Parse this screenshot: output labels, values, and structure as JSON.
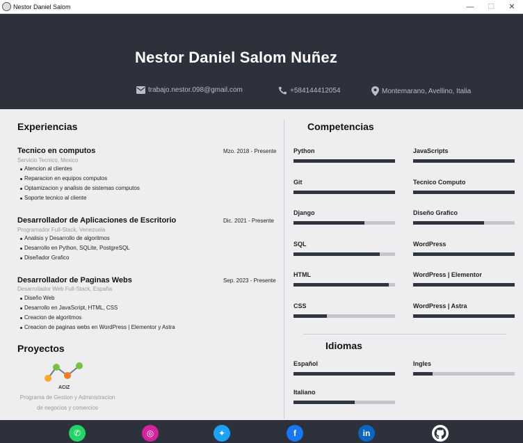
{
  "window": {
    "title": "Nestor Daniel Salom",
    "controls": [
      "—",
      "☐",
      "✕"
    ]
  },
  "header": {
    "name": "Nestor Daniel Salom Nuñez",
    "email": "trabajo.nestor.098@gmail.com",
    "phone": "+584144412054",
    "location": "Montemarano, Avellino, Italia"
  },
  "experience": {
    "heading": "Experiencias",
    "jobs": [
      {
        "title": "Tecnico en computos",
        "date": "Mzo. 2018 - Presente",
        "subtitle": "Servicio Tecnico, Mexico",
        "items": [
          "Atencion al clientes",
          "Reparacion en equipos computos",
          "Optamizacion y analisis de sistemas computos",
          "Soporte tecnico al cliente"
        ]
      },
      {
        "title": "Desarrollador de Aplicaciones de Escritorio",
        "date": "Dic. 2021 - Presente",
        "subtitle": "Programador Full-Stack, Venezuela",
        "items": [
          "Analisis y Desarrollo de algoritmos",
          "Desarrollo en Python, SQLite, PostgreSQL",
          "Diseñador Grafico"
        ]
      },
      {
        "title": "Desarrollador de Paginas Webs",
        "date": "Sep. 2023 - Presente",
        "subtitle": "Desarrollador Web Full-Stack, España",
        "items": [
          "Diseño Web",
          "Desarrollo en JavaScript, HTML, CSS",
          "Creacion de algoritmos",
          "Creacion de paginas webs en WordPress | Elementor y Astra"
        ]
      }
    ]
  },
  "projects": {
    "heading": "Proyectos",
    "logo_text": "ACIZ",
    "description_line1": "Programa de Gestion y Administracion",
    "description_line2": "de negocios y comercios"
  },
  "skills": {
    "heading": "Competencias",
    "items": [
      {
        "name": "Python",
        "level": 1.0
      },
      {
        "name": "JavaScripts",
        "level": 1.0
      },
      {
        "name": "Git",
        "level": 1.0
      },
      {
        "name": "Tecnico Computo",
        "level": 1.0
      },
      {
        "name": "Django",
        "level": 0.7
      },
      {
        "name": "Diseño Grafico",
        "level": 0.7
      },
      {
        "name": "SQL",
        "level": 0.85
      },
      {
        "name": "WordPress",
        "level": 1.0
      },
      {
        "name": "HTML",
        "level": 0.94
      },
      {
        "name": "WordPress | Elementor",
        "level": 1.0
      },
      {
        "name": "CSS",
        "level": 0.33
      },
      {
        "name": "WordPress | Astra",
        "level": 1.0
      }
    ]
  },
  "languages": {
    "heading": "Idiomas",
    "items": [
      {
        "name": "Español",
        "level": 1.0
      },
      {
        "name": "Ingles",
        "level": 0.19
      },
      {
        "name": "Italiano",
        "level": 0.6
      }
    ]
  },
  "social": [
    {
      "name": "WhatsApp",
      "icon": "whatsapp-icon",
      "color": "#25d366"
    },
    {
      "name": "Instagram",
      "icon": "instagram-icon",
      "color": "#d6249f"
    },
    {
      "name": "Twitter",
      "icon": "twitter-icon",
      "color": "#1da1f2"
    },
    {
      "name": "Facebook",
      "icon": "facebook-icon",
      "color": "#1877f2"
    },
    {
      "name": "LinkedIn",
      "icon": "linkedin-icon",
      "color": "#0a66c2"
    },
    {
      "name": "GitHub",
      "icon": "github-icon",
      "color": "#ffffff"
    }
  ],
  "colors": {
    "header_bg": "#2c313c",
    "page_bg": "#eeeef0",
    "bar_fill": "#2e3440",
    "bar_track": "#c6c6ca"
  }
}
